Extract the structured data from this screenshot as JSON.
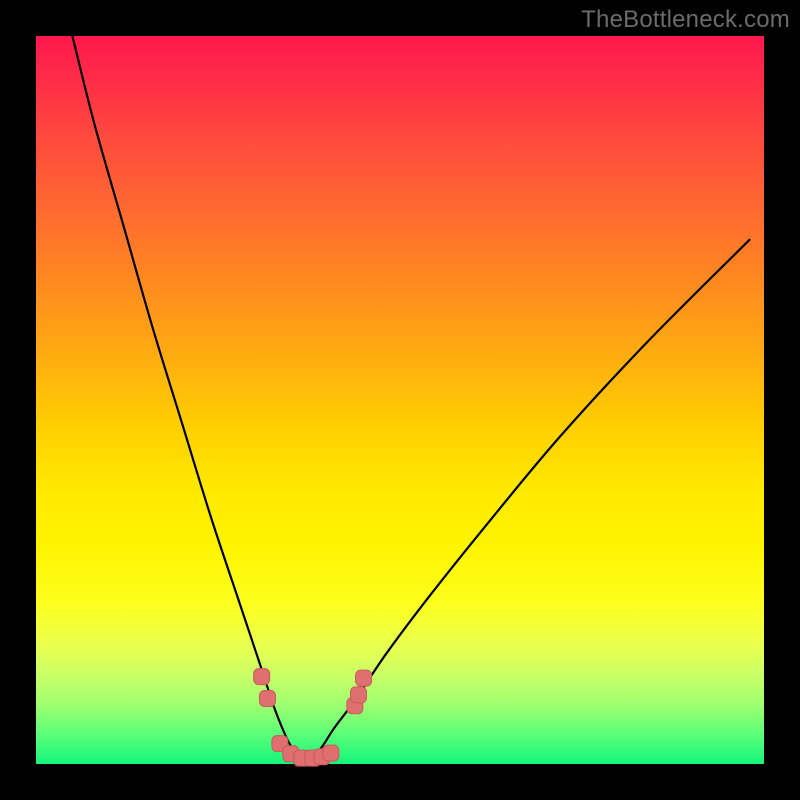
{
  "watermark": {
    "text": "TheBottleneck.com"
  },
  "colors": {
    "background": "#000000",
    "curve": "#000000",
    "marker_fill": "#e07070",
    "marker_outline": "#c75a5a",
    "gradient_top": "#ff184d",
    "gradient_bottom": "#13f57b"
  },
  "chart_data": {
    "type": "line",
    "title": "",
    "xlabel": "",
    "ylabel": "",
    "xlim": [
      0,
      100
    ],
    "ylim": [
      0,
      100
    ],
    "grid": false,
    "legend": false,
    "note": "Axes unlabeled; values are relative 0–100 estimates read from pixel positions. Y=0 is bottom (green), Y=100 is top (red). The curve is a V shape bottoming near x≈37.",
    "series": [
      {
        "name": "bottleneck-curve",
        "x": [
          5,
          8,
          12,
          16,
          20,
          24,
          28,
          31,
          33,
          35,
          37,
          39,
          41,
          44,
          48,
          54,
          62,
          72,
          84,
          98
        ],
        "y": [
          100,
          88,
          74,
          60,
          47,
          34,
          22,
          13,
          7,
          2.5,
          0.5,
          2,
          5,
          9,
          15,
          23,
          33,
          45,
          58,
          72
        ]
      }
    ],
    "markers": {
      "name": "highlight-dots",
      "note": "Rounded-square pink markers clustered near the trough of the V.",
      "points": [
        {
          "x": 31.0,
          "y": 12.0
        },
        {
          "x": 31.8,
          "y": 9.0
        },
        {
          "x": 33.5,
          "y": 2.8
        },
        {
          "x": 35.0,
          "y": 1.4
        },
        {
          "x": 36.5,
          "y": 0.8
        },
        {
          "x": 38.0,
          "y": 0.8
        },
        {
          "x": 39.3,
          "y": 1.0
        },
        {
          "x": 40.5,
          "y": 1.5
        },
        {
          "x": 43.8,
          "y": 8.0
        },
        {
          "x": 44.3,
          "y": 9.5
        },
        {
          "x": 45.0,
          "y": 11.8
        }
      ]
    }
  }
}
